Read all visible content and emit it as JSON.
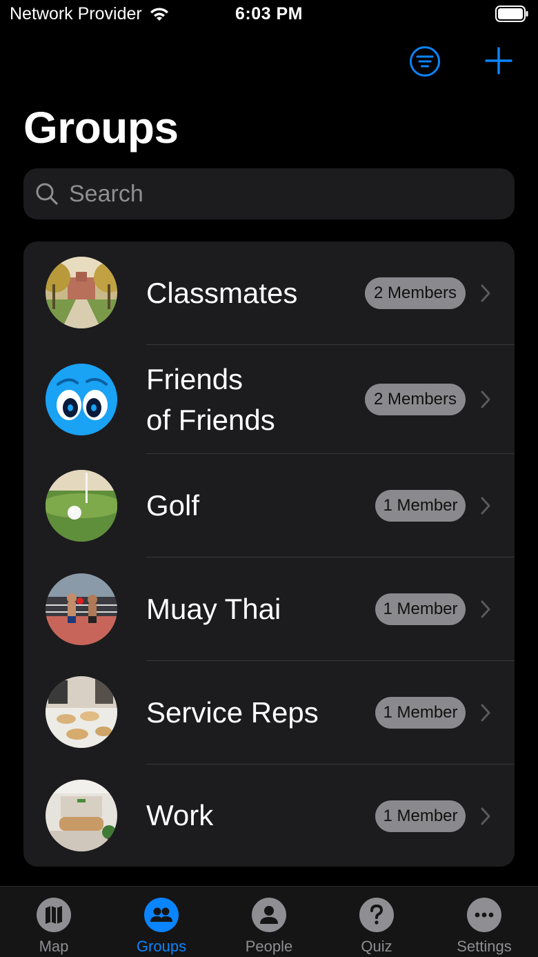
{
  "status_bar": {
    "carrier": "Network Provider",
    "time": "6:03 PM"
  },
  "header": {
    "title": "Groups"
  },
  "search": {
    "placeholder": "Search"
  },
  "groups": [
    {
      "name": "Classmates",
      "members": "2 Members",
      "avatar": "campus-photo"
    },
    {
      "name_line1": "Friends",
      "name_line2": "of Friends",
      "members": "2 Members",
      "avatar": "cartoon-eyes"
    },
    {
      "name": "Golf",
      "members": "1 Member",
      "avatar": "golf-ball-photo"
    },
    {
      "name": "Muay Thai",
      "members": "1 Member",
      "avatar": "boxing-ring-photo"
    },
    {
      "name": "Service Reps",
      "members": "1 Member",
      "avatar": "bakery-counter-photo"
    },
    {
      "name": "Work",
      "members": "1 Member",
      "avatar": "office-lobby-photo"
    }
  ],
  "tabs": [
    {
      "label": "Map",
      "icon": "map-icon"
    },
    {
      "label": "Groups",
      "icon": "groups-icon",
      "active": true
    },
    {
      "label": "People",
      "icon": "person-icon"
    },
    {
      "label": "Quiz",
      "icon": "question-icon"
    },
    {
      "label": "Settings",
      "icon": "more-icon"
    }
  ],
  "colors": {
    "accent": "#0a84ff",
    "background": "#000000",
    "card": "#1c1c1e",
    "badge": "#8a8a8e"
  }
}
